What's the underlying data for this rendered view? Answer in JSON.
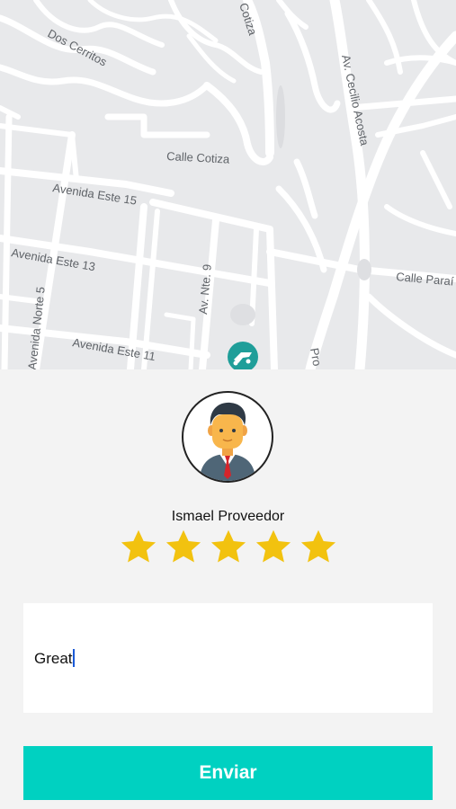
{
  "map": {
    "streets": [
      "Dos Cerritos",
      "Cotiza",
      "Av. Cecilio Acosta",
      "Calle Cotiza",
      "Avenida Este 15",
      "Avenida Este 13",
      "Av. Nte. 9",
      "Calle Paraí",
      "Avenida Norte 5",
      "Avenida Este 11",
      "Pro"
    ],
    "marker_icon": "car-marker-icon"
  },
  "provider": {
    "name": "Ismael Proveedor",
    "avatar_icon": "businessman-avatar-icon",
    "rating": 5,
    "rating_max": 5
  },
  "comment": {
    "value": "Great"
  },
  "send_button": {
    "label": "Enviar"
  },
  "colors": {
    "accent": "#00d1c1",
    "star": "#f2c20f",
    "map_bg": "#e8e9eb",
    "road": "#ffffff"
  }
}
